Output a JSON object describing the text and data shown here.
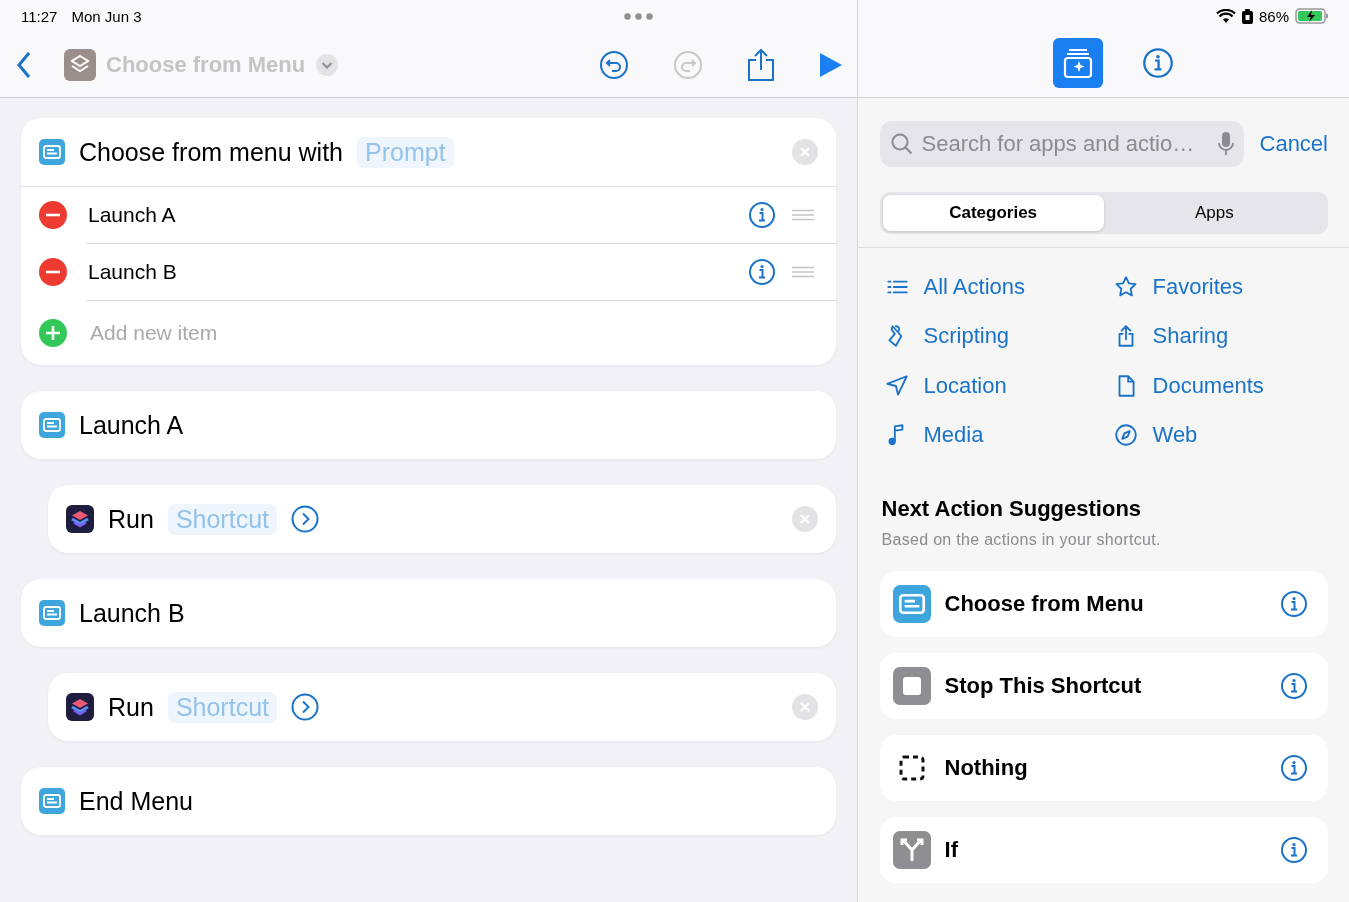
{
  "status_bar": {
    "time": "11:27",
    "date": "Mon Jun 3",
    "battery": "86%"
  },
  "toolbar": {
    "title": "Choose from Menu",
    "undo_enabled": true,
    "redo_enabled": false
  },
  "editor": {
    "blocks": [
      {
        "kind": "menu",
        "label": "Choose from menu with",
        "token": "Prompt",
        "items": [
          {
            "label": "Launch A"
          },
          {
            "label": "Launch B"
          }
        ],
        "add_placeholder": "Add new item"
      },
      {
        "kind": "case",
        "label": "Launch A",
        "children": [
          {
            "kind": "action",
            "label": "Run",
            "token": "Shortcut"
          }
        ]
      },
      {
        "kind": "case",
        "label": "Launch B",
        "children": [
          {
            "kind": "action",
            "label": "Run",
            "token": "Shortcut"
          }
        ]
      },
      {
        "kind": "end",
        "label": "End Menu"
      }
    ]
  },
  "panel_buttons": [
    {
      "kind": "library",
      "selected": true
    },
    {
      "kind": "info",
      "selected": false
    }
  ],
  "search": {
    "placeholder": "Search for apps and actio…",
    "cancel": "Cancel"
  },
  "tabs": [
    {
      "label": "Categories",
      "selected": true
    },
    {
      "label": "Apps",
      "selected": false
    }
  ],
  "categories": [
    {
      "label": "All Actions"
    },
    {
      "label": "Favorites"
    },
    {
      "label": "Scripting"
    },
    {
      "label": "Sharing"
    },
    {
      "label": "Location"
    },
    {
      "label": "Documents"
    },
    {
      "label": "Media"
    },
    {
      "label": "Web"
    }
  ],
  "suggestions": {
    "heading": "Next Action Suggestions",
    "subtitle": "Based on the actions in your shortcut.",
    "items": [
      {
        "kind": "menu",
        "label": "Choose from Menu"
      },
      {
        "kind": "stop",
        "label": "Stop This Shortcut"
      },
      {
        "kind": "nothing",
        "label": "Nothing"
      },
      {
        "kind": "if",
        "label": "If"
      }
    ]
  }
}
